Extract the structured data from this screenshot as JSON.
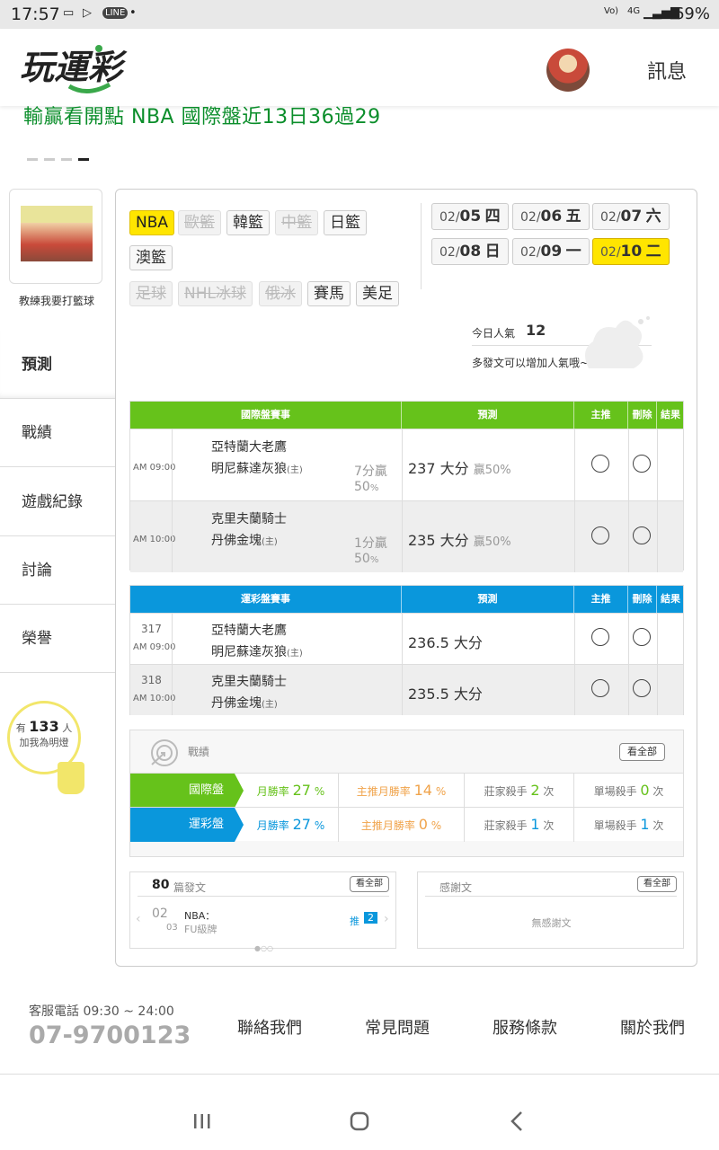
{
  "status": {
    "time": "17:57",
    "battery": "69%",
    "net": "4G"
  },
  "header": {
    "logo_text": "玩運彩",
    "message": "訊息"
  },
  "ticker": "輸贏看開點 NBA 國際盤近13日36過29",
  "sidebar": {
    "user_name": "教練我要打籃球",
    "nav": [
      "預測",
      "戰績",
      "遊戲紀錄",
      "討論",
      "榮譽"
    ],
    "bulb_prefix": "有",
    "bulb_count": "133",
    "bulb_suffix": "人",
    "bulb_line2": "加我為明燈"
  },
  "sports": [
    {
      "label": "NBA"
    },
    {
      "label": "歐籃"
    },
    {
      "label": "韓籃"
    },
    {
      "label": "中籃"
    },
    {
      "label": "日籃"
    },
    {
      "label": "澳籃"
    },
    {
      "label": "足球"
    },
    {
      "label": "NHL冰球"
    },
    {
      "label": "俄冰"
    },
    {
      "label": "賽馬"
    },
    {
      "label": "美足"
    }
  ],
  "dates": [
    {
      "m": "02/",
      "d": "05",
      "w": "四"
    },
    {
      "m": "02/",
      "d": "06",
      "w": "五"
    },
    {
      "m": "02/",
      "d": "07",
      "w": "六"
    },
    {
      "m": "02/",
      "d": "08",
      "w": "日"
    },
    {
      "m": "02/",
      "d": "09",
      "w": "一"
    },
    {
      "m": "02/",
      "d": "10",
      "w": "二"
    }
  ],
  "popularity": {
    "label": "今日人氣",
    "value": "12",
    "hint": "多發文可以增加人氣哦~"
  },
  "intl_table": {
    "headers": [
      "國際盤賽事",
      "預測",
      "主推",
      "刪除",
      "結果"
    ],
    "rows": [
      {
        "time": "AM 09:00",
        "away": "亞特蘭大老鷹",
        "home": "明尼蘇達灰狼",
        "home_tag": "(主)",
        "spread": "7分贏",
        "spread_pct": "50",
        "pct_sign": "%",
        "pick": "237 大分",
        "pick_note": "贏50%"
      },
      {
        "time": "AM 10:00",
        "away": "克里夫蘭騎士",
        "home": "丹佛金塊",
        "home_tag": "(主)",
        "spread": "1分贏",
        "spread_pct": "50",
        "pct_sign": "%",
        "pick": "235 大分",
        "pick_note": "贏50%"
      }
    ]
  },
  "lottery_table": {
    "headers": [
      "運彩盤賽事",
      "預測",
      "主推",
      "刪除",
      "結果"
    ],
    "rows": [
      {
        "num": "317",
        "time": "AM 09:00",
        "away": "亞特蘭大老鷹",
        "home": "明尼蘇達灰狼",
        "home_tag": "(主)",
        "pick": "236.5 大分"
      },
      {
        "num": "318",
        "time": "AM 10:00",
        "away": "克里夫蘭騎士",
        "home": "丹佛金塊",
        "home_tag": "(主)",
        "pick": "235.5 大分"
      }
    ]
  },
  "record": {
    "title": "戰績",
    "view_all": "看全部",
    "rows": [
      {
        "tag": "國際盤",
        "month_label": "月勝率",
        "month": "27",
        "home_label": "主推月勝率",
        "home": "14",
        "pct": "%",
        "killer_label": "莊家殺手",
        "killer": "2",
        "single_label": "單場殺手",
        "single": "0",
        "unit": "次"
      },
      {
        "tag": "運彩盤",
        "month_label": "月勝率",
        "month": "27",
        "home_label": "主推月勝率",
        "home": "0",
        "pct": "%",
        "killer_label": "莊家殺手",
        "killer": "1",
        "single_label": "單場殺手",
        "single": "1",
        "unit": "次"
      }
    ]
  },
  "posts": {
    "count": "80",
    "label": "篇發文",
    "view_all": "看全部",
    "day": "02",
    "month": "03",
    "title": "NBA：",
    "sub": "FU級牌",
    "push": "推",
    "push_count": "2"
  },
  "thanks": {
    "label": "感謝文",
    "view_all": "看全部",
    "empty": "無感謝文"
  },
  "footer": {
    "hours": "客服電話 09:30 ~ 24:00",
    "phone": "07-9700123",
    "links": [
      "聯絡我們",
      "常見問題",
      "服務條款",
      "關於我們"
    ]
  },
  "colors": {
    "green": "#66c21b",
    "blue": "#0a97dc",
    "yellow": "#ffe500",
    "ticker": "#0b8e2b"
  }
}
